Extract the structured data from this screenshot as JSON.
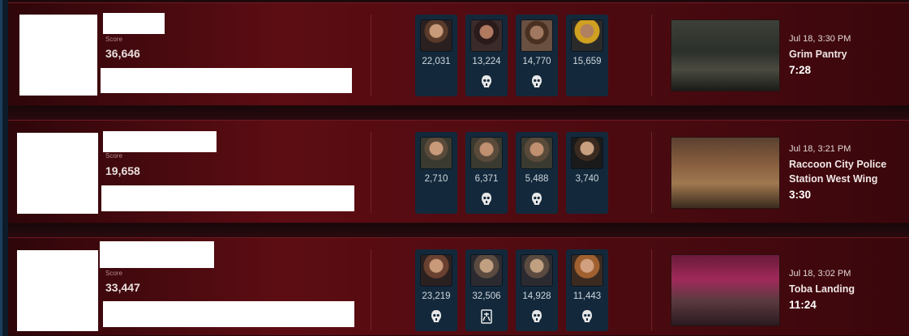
{
  "matches": [
    {
      "score_label": "Score",
      "score": "36,646",
      "survivors": [
        {
          "score": "22,031",
          "status": "escaped",
          "portrait": "survivor-portrait-1"
        },
        {
          "score": "13,224",
          "status": "sacrificed",
          "portrait": "survivor-portrait-2"
        },
        {
          "score": "14,770",
          "status": "sacrificed",
          "portrait": "survivor-portrait-3"
        },
        {
          "score": "15,659",
          "status": "escaped",
          "portrait": "survivor-portrait-4"
        }
      ],
      "map": {
        "date": "Jul 18, 3:30 PM",
        "name_line1": "Grim Pantry",
        "name_line2": "",
        "duration": "7:28"
      }
    },
    {
      "score_label": "Score",
      "score": "19,658",
      "survivors": [
        {
          "score": "2,710",
          "status": "escaped",
          "portrait": "survivor-portrait-1"
        },
        {
          "score": "6,371",
          "status": "sacrificed",
          "portrait": "survivor-portrait-2"
        },
        {
          "score": "5,488",
          "status": "sacrificed",
          "portrait": "survivor-portrait-3"
        },
        {
          "score": "3,740",
          "status": "escaped",
          "portrait": "survivor-portrait-4"
        }
      ],
      "map": {
        "date": "Jul 18, 3:21 PM",
        "name_line1": "Raccoon City Police",
        "name_line2": "Station West Wing",
        "duration": "3:30"
      }
    },
    {
      "score_label": "Score",
      "score": "33,447",
      "survivors": [
        {
          "score": "23,219",
          "status": "sacrificed",
          "portrait": "survivor-portrait-1"
        },
        {
          "score": "32,506",
          "status": "killed",
          "portrait": "survivor-portrait-2"
        },
        {
          "score": "14,928",
          "status": "sacrificed",
          "portrait": "survivor-portrait-3"
        },
        {
          "score": "11,443",
          "status": "sacrificed",
          "portrait": "survivor-portrait-4"
        }
      ],
      "map": {
        "date": "Jul 18, 3:02 PM",
        "name_line1": "Toba Landing",
        "name_line2": "",
        "duration": "11:24"
      }
    }
  ],
  "colors": {
    "panel_red": "#5c0d13",
    "survivor_card": "#13293b"
  }
}
